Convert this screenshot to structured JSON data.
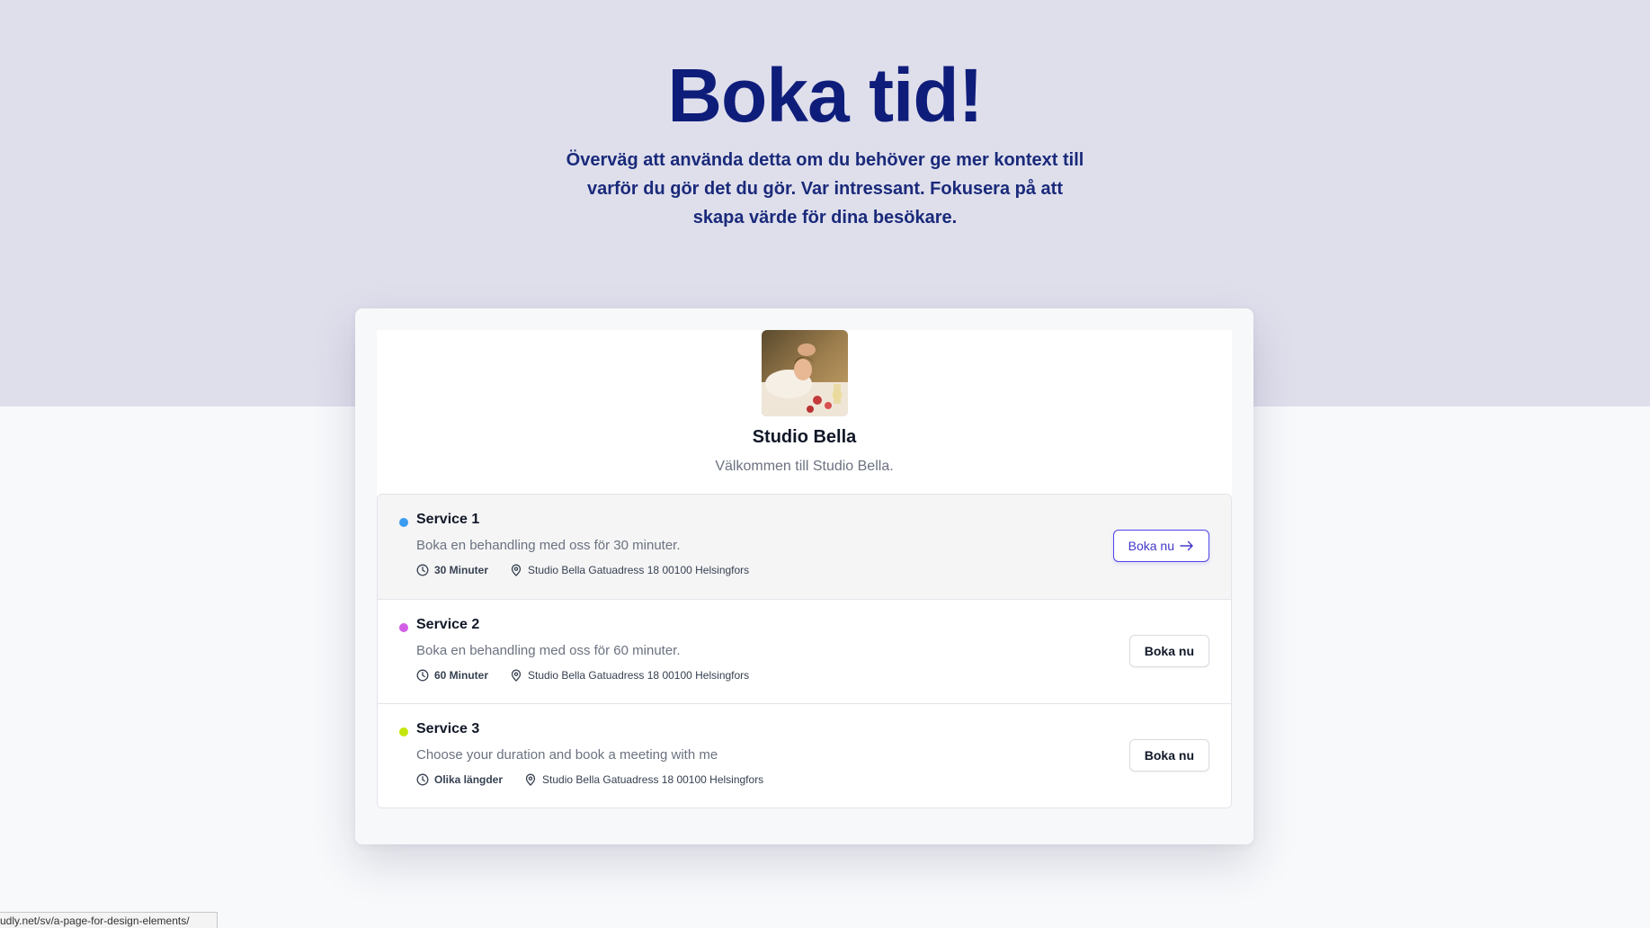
{
  "hero": {
    "title": "Boka tid!",
    "text": "Överväg att använda detta om du behöver ge mer kontext till varför du gör det du gör. Var intressant. Fokusera på att skapa värde för dina besökare."
  },
  "profile": {
    "name": "Studio Bella",
    "description": "Välkommen till Studio Bella."
  },
  "services": [
    {
      "title": "Service 1",
      "description": "Boka en behandling med oss för 30 minuter.",
      "duration": "30 Minuter",
      "location": "Studio Bella Gatuadress 18 00100 Helsingfors",
      "button": "Boka nu",
      "dot_color": "#3b9bf0",
      "highlighted": true
    },
    {
      "title": "Service 2",
      "description": "Boka en behandling med oss för 60 minuter.",
      "duration": "60 Minuter",
      "location": "Studio Bella Gatuadress 18 00100 Helsingfors",
      "button": "Boka nu",
      "dot_color": "#d35ee6",
      "highlighted": false
    },
    {
      "title": "Service 3",
      "description": "Choose your duration and book a meeting with me",
      "duration": "Olika längder",
      "location": "Studio Bella Gatuadress 18 00100 Helsingfors",
      "button": "Boka nu",
      "dot_color": "#c4e60c",
      "highlighted": false
    }
  ],
  "status_bar": {
    "url": "udly.net/sv/a-page-for-design-elements/"
  },
  "colors": {
    "hero_bg": "#dfdfec",
    "title": "#0f1d7a",
    "accent": "#4f46e5"
  }
}
